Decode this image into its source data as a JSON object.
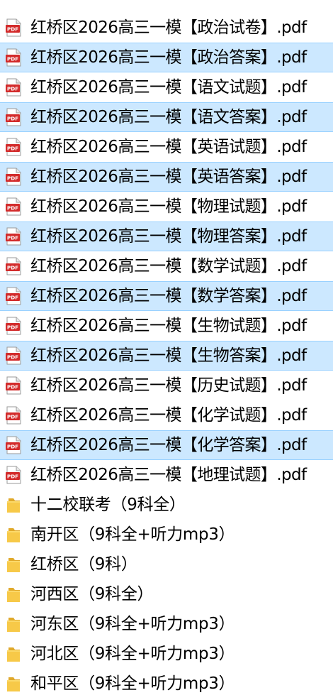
{
  "colors": {
    "selection_bg": "#cce8ff",
    "selection_border": "#99d1ff",
    "pdf_icon_red": "#d32b2b",
    "folder_yellow": "#f7c948"
  },
  "items": [
    {
      "type": "pdf",
      "icon": "pdf-file-icon",
      "name": "红桥区2026高三一模【政治试卷】.pdf",
      "selected": false
    },
    {
      "type": "pdf",
      "icon": "pdf-file-icon",
      "name": "红桥区2026高三一模【政治答案】.pdf",
      "selected": true
    },
    {
      "type": "pdf",
      "icon": "pdf-file-icon",
      "name": "红桥区2026高三一模【语文试题】.pdf",
      "selected": false
    },
    {
      "type": "pdf",
      "icon": "pdf-file-icon",
      "name": "红桥区2026高三一模【语文答案】.pdf",
      "selected": true
    },
    {
      "type": "pdf",
      "icon": "pdf-file-icon",
      "name": "红桥区2026高三一模【英语试题】.pdf",
      "selected": false
    },
    {
      "type": "pdf",
      "icon": "pdf-file-icon",
      "name": "红桥区2026高三一模【英语答案】.pdf",
      "selected": true
    },
    {
      "type": "pdf",
      "icon": "pdf-file-icon",
      "name": "红桥区2026高三一模【物理试题】.pdf",
      "selected": false
    },
    {
      "type": "pdf",
      "icon": "pdf-file-icon",
      "name": "红桥区2026高三一模【物理答案】.pdf",
      "selected": true
    },
    {
      "type": "pdf",
      "icon": "pdf-file-icon",
      "name": "红桥区2026高三一模【数学试题】.pdf",
      "selected": false
    },
    {
      "type": "pdf",
      "icon": "pdf-file-icon",
      "name": "红桥区2026高三一模【数学答案】.pdf",
      "selected": true
    },
    {
      "type": "pdf",
      "icon": "pdf-file-icon",
      "name": "红桥区2026高三一模【生物试题】.pdf",
      "selected": false
    },
    {
      "type": "pdf",
      "icon": "pdf-file-icon",
      "name": "红桥区2026高三一模【生物答案】.pdf",
      "selected": true
    },
    {
      "type": "pdf",
      "icon": "pdf-file-icon",
      "name": "红桥区2026高三一模【历史试题】.pdf",
      "selected": false
    },
    {
      "type": "pdf",
      "icon": "pdf-file-icon",
      "name": "红桥区2026高三一模【化学试题】.pdf",
      "selected": false
    },
    {
      "type": "pdf",
      "icon": "pdf-file-icon",
      "name": "红桥区2026高三一模【化学答案】.pdf",
      "selected": true
    },
    {
      "type": "pdf",
      "icon": "pdf-file-icon",
      "name": "红桥区2026高三一模【地理试题】.pdf",
      "selected": false
    },
    {
      "type": "folder",
      "icon": "folder-icon",
      "name": "十二校联考（9科全）",
      "selected": false
    },
    {
      "type": "folder",
      "icon": "folder-icon",
      "name": "南开区（9科全+听力mp3）",
      "selected": false
    },
    {
      "type": "folder",
      "icon": "folder-icon",
      "name": "红桥区（9科）",
      "selected": false
    },
    {
      "type": "folder",
      "icon": "folder-icon",
      "name": "河西区（9科全）",
      "selected": false
    },
    {
      "type": "folder",
      "icon": "folder-icon",
      "name": "河东区（9科全+听力mp3）",
      "selected": false
    },
    {
      "type": "folder",
      "icon": "folder-icon",
      "name": "河北区（9科全+听力mp3）",
      "selected": false
    },
    {
      "type": "folder",
      "icon": "folder-icon",
      "name": "和平区（9科全+听力mp3）",
      "selected": false
    }
  ]
}
